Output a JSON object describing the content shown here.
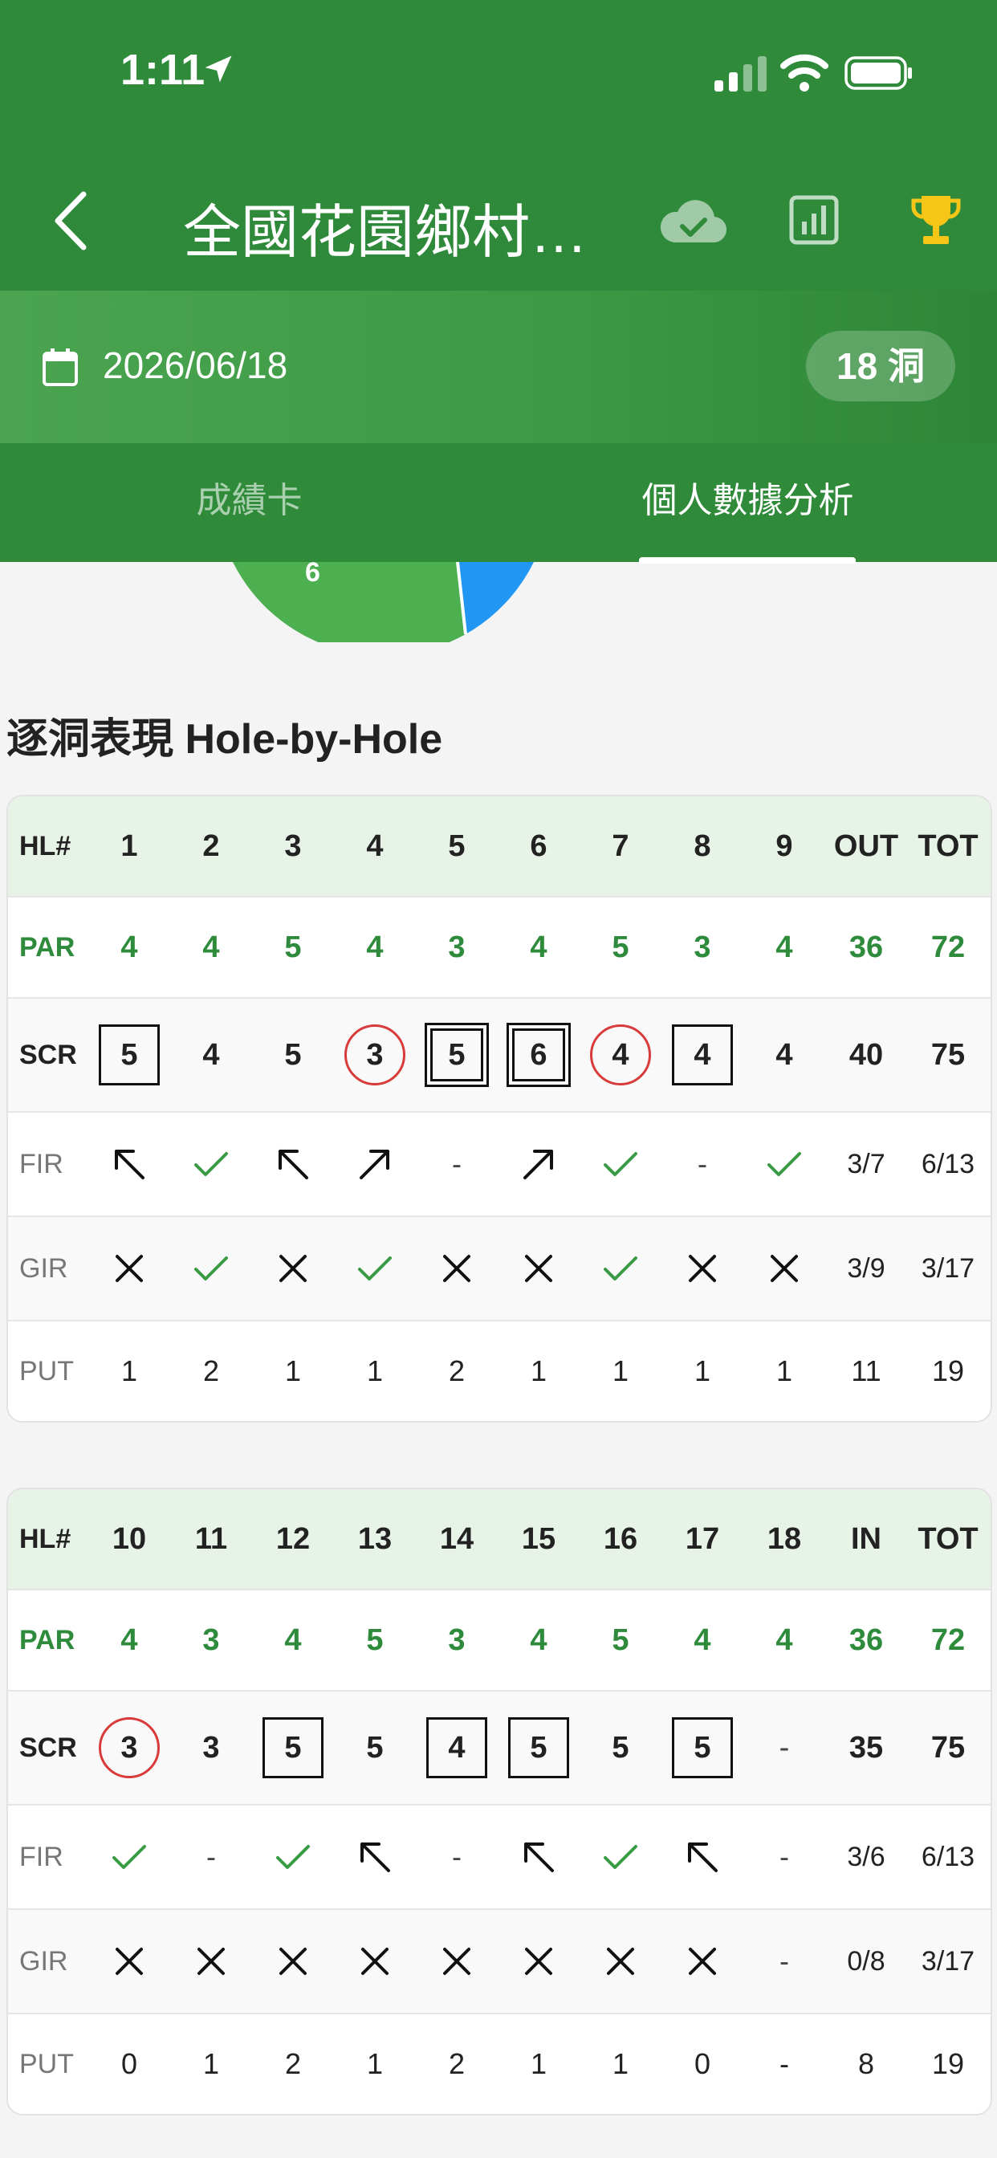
{
  "status": {
    "time": "1:11"
  },
  "nav": {
    "title": "全國花園鄉村…"
  },
  "date": {
    "value": "2026/06/18",
    "holes_badge": "18 洞"
  },
  "tabs": [
    {
      "label": "成績卡",
      "active": false
    },
    {
      "label": "個人數據分析",
      "active": true
    }
  ],
  "pie_label": "6",
  "section_title": "逐洞表現 Hole-by-Hole",
  "colors": {
    "green": "#2e8b3b",
    "birdie_red": "#d93a3a",
    "blue_slice": "#2196f3",
    "green_slice": "#4caf50"
  },
  "row_labels": {
    "hole": "HL#",
    "par": "PAR",
    "score": "SCR",
    "fir": "FIR",
    "gir": "GIR",
    "put": "PUT"
  },
  "front_nine": {
    "holes": [
      "1",
      "2",
      "3",
      "4",
      "5",
      "6",
      "7",
      "8",
      "9"
    ],
    "subtotal_label": "OUT",
    "total_label": "TOT",
    "par": [
      "4",
      "4",
      "5",
      "4",
      "3",
      "4",
      "5",
      "3",
      "4"
    ],
    "par_sub": "36",
    "par_tot": "72",
    "score": [
      {
        "v": "5",
        "mark": "box"
      },
      {
        "v": "4",
        "mark": "none"
      },
      {
        "v": "5",
        "mark": "none"
      },
      {
        "v": "3",
        "mark": "circle"
      },
      {
        "v": "5",
        "mark": "dbox"
      },
      {
        "v": "6",
        "mark": "dbox"
      },
      {
        "v": "4",
        "mark": "circle"
      },
      {
        "v": "4",
        "mark": "box"
      },
      {
        "v": "4",
        "mark": "none"
      }
    ],
    "score_sub": "40",
    "score_tot": "75",
    "fir": [
      "arrow-up-left-icon",
      "check-icon",
      "arrow-up-left-icon",
      "arrow-up-right-icon",
      "dash",
      "arrow-up-right-icon",
      "check-icon",
      "dash",
      "check-icon"
    ],
    "fir_sub": "3/7",
    "fir_tot": "6/13",
    "gir": [
      "cross-icon",
      "check-icon",
      "cross-icon",
      "check-icon",
      "cross-icon",
      "cross-icon",
      "check-icon",
      "cross-icon",
      "cross-icon"
    ],
    "gir_sub": "3/9",
    "gir_tot": "3/17",
    "put": [
      "1",
      "2",
      "1",
      "1",
      "2",
      "1",
      "1",
      "1",
      "1"
    ],
    "put_sub": "11",
    "put_tot": "19"
  },
  "back_nine": {
    "holes": [
      "10",
      "11",
      "12",
      "13",
      "14",
      "15",
      "16",
      "17",
      "18"
    ],
    "subtotal_label": "IN",
    "total_label": "TOT",
    "par": [
      "4",
      "3",
      "4",
      "5",
      "3",
      "4",
      "5",
      "4",
      "4"
    ],
    "par_sub": "36",
    "par_tot": "72",
    "score": [
      {
        "v": "3",
        "mark": "circle"
      },
      {
        "v": "3",
        "mark": "none"
      },
      {
        "v": "5",
        "mark": "box"
      },
      {
        "v": "5",
        "mark": "none"
      },
      {
        "v": "4",
        "mark": "box"
      },
      {
        "v": "5",
        "mark": "box"
      },
      {
        "v": "5",
        "mark": "none"
      },
      {
        "v": "5",
        "mark": "box"
      },
      {
        "v": "-",
        "mark": "none"
      }
    ],
    "score_sub": "35",
    "score_tot": "75",
    "fir": [
      "check-icon",
      "dash",
      "check-icon",
      "arrow-up-left-icon",
      "dash",
      "arrow-up-left-icon",
      "check-icon",
      "arrow-up-left-icon",
      "dash"
    ],
    "fir_sub": "3/6",
    "fir_tot": "6/13",
    "gir": [
      "cross-icon",
      "cross-icon",
      "cross-icon",
      "cross-icon",
      "cross-icon",
      "cross-icon",
      "cross-icon",
      "cross-icon",
      "dash"
    ],
    "gir_sub": "0/8",
    "gir_tot": "3/17",
    "put": [
      "0",
      "1",
      "2",
      "1",
      "2",
      "1",
      "1",
      "0",
      "-"
    ],
    "put_sub": "8",
    "put_tot": "19"
  }
}
